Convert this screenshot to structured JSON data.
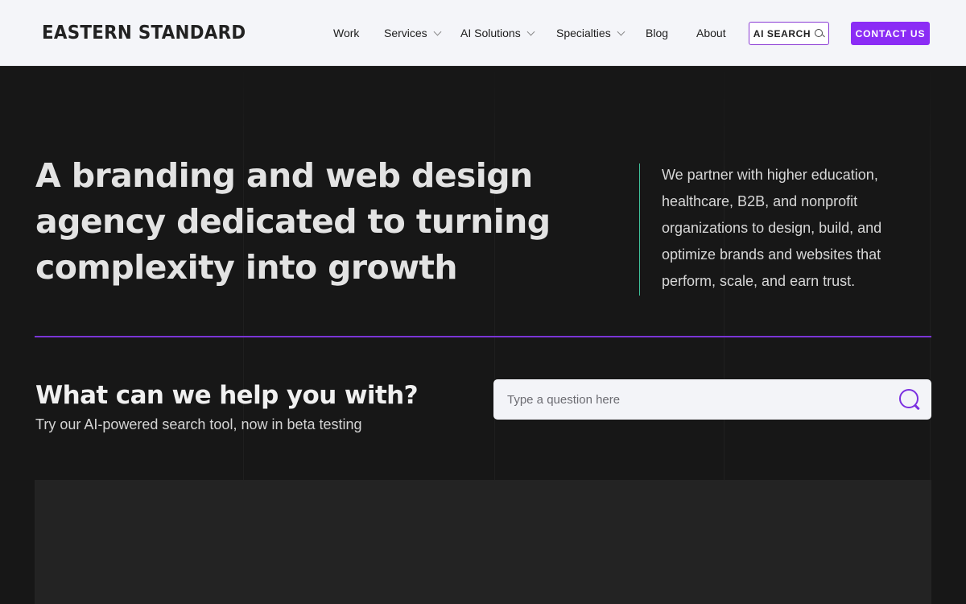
{
  "header": {
    "logo": "EASTERN STANDARD",
    "nav": [
      {
        "label": "Work",
        "dropdown": false
      },
      {
        "label": "Services",
        "dropdown": true
      },
      {
        "label": "AI Solutions",
        "dropdown": true
      },
      {
        "label": "Specialties",
        "dropdown": true
      },
      {
        "label": "Blog",
        "dropdown": false
      },
      {
        "label": "About",
        "dropdown": false
      }
    ],
    "ai_search_label": "AI SEARCH",
    "contact_label": "CONTACT US"
  },
  "hero": {
    "title": "A branding and web design agency dedicated to turning complexity into growth",
    "description": "We partner with higher education, healthcare, B2B, and nonprofit organizations to design, build, and optimize brands and websites that perform, scale, and earn trust."
  },
  "help": {
    "title": "What can we help you with?",
    "subtitle": "Try our AI-powered search tool, now in beta testing",
    "search_placeholder": "Type a question here"
  },
  "colors": {
    "accent_purple": "#8b2cf5",
    "divider_green": "#3fbf9a",
    "rule_purple": "#7a35d6",
    "background": "#171717"
  }
}
